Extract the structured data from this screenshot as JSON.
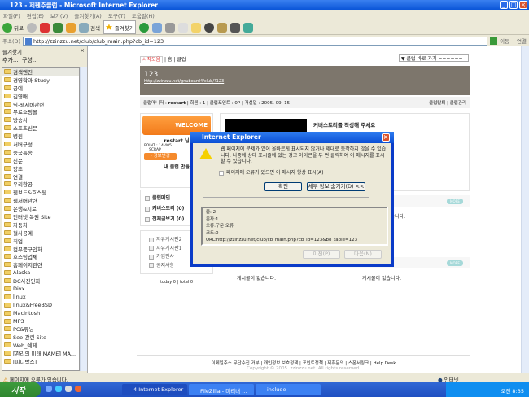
{
  "window": {
    "title": "123 - 제펜주클럽 - Microsoft Internet Explorer"
  },
  "menu": [
    "파일(F)",
    "편집(E)",
    "보기(V)",
    "즐겨찾기(A)",
    "도구(T)",
    "도움말(H)"
  ],
  "toolbar": {
    "back": "뒤로",
    "search": "검색",
    "favorites": "즐겨찾기"
  },
  "address": {
    "label": "주소(D)",
    "url": "http://zzinzzu.net/club/club_main.php?cb_id=123",
    "go": "이동",
    "links": "연결"
  },
  "favorites": {
    "title": "즐겨찾기",
    "add": "추가...",
    "organize": "구성...",
    "items": [
      "검색엔진",
      "경영학과-Study",
      "공예",
      "김영배",
      "딕-웹서버관련",
      "무료쇼핑몰",
      "방송사",
      "스포츠신문",
      "병원",
      "서버구성",
      "중국특송",
      "신문",
      "양초",
      "연결",
      "우리항공",
      "웹보드&호스팅",
      "웹서버관련",
      "은행&지로",
      "인터넷 복권 Site",
      "자동차",
      "철사공예",
      "취업",
      "컴부품구입처",
      "호스팅업체",
      "홈페이지관련",
      "Alaska",
      "DC사진인화",
      "Divx",
      "linux",
      "linux&FreeBSD",
      "Macintosh",
      "MP3",
      "PC&튜닝",
      "See-관련 Site",
      "Web_예제",
      "[관리의 미래 MAME] MA...",
      "[피디박스]"
    ]
  },
  "page": {
    "nav": [
      "시작모음",
      "홈",
      "클럽"
    ],
    "club_select": "▼ 클럽 바로 가기 ======",
    "club_name": "123",
    "club_url": "http://zzinzzu.net/gnuboard4/club/?123",
    "info": {
      "manager_label": "클럽매니저 :",
      "manager": "restart",
      "members": "| 회원 : 1 | 클럽포인트 : 0P | 개설일 : 2005. 09. 15"
    },
    "links": "클럽탈퇴 | 클럽관리",
    "welcome": "WELCOME",
    "user": "restart 님",
    "point": "POINT : 14,405",
    "scrap": "SCRAP",
    "btn_info": "· 정보변경",
    "make_club": "내 클럽 만들",
    "story_prompt": "커버스토리를 작성해 주세요",
    "menu": [
      "클럽메인",
      "커버스토리 (0)",
      "전체글보기 (0)"
    ],
    "boards": [
      "자유게시판2",
      "자유게시판1",
      "가입인사",
      "공지사항"
    ],
    "counter": "today 0 | total 0",
    "no_posts": "게시물이 없습니다.",
    "more": "MORE",
    "footer": "이메일주소 무단수집 거부 | 개인정보 보호정책 | 포인트정책 | 제휴문의 | 스폰서링크 | Help Desk",
    "copyright": "Copyright © 2005. zzinzzu.net. All rights reserved."
  },
  "dialog": {
    "title": "Internet Explorer",
    "message": "웹 페이지에 문제가 있어 올바르게 표시되지 않거나 제대로 동작하지 않을 수 있습니다. 나중에 상태 표시줄에 있는 경고 아이콘을 두 번 클릭하여 이 메시지를 표시할 수 있습니다.",
    "checkbox": "페이지에 오류가 있으면 이 메시지 항상 표시(A)",
    "ok": "확인",
    "details": "세부 정보 숨기기(D) <<",
    "details_lines": [
      "줄:  2",
      "문자:1",
      "오류:구문 오류",
      "코드:0",
      "URL:http://zzinzzu.net/club/cb_main.php?cb_id=123&bo_table=123"
    ],
    "prev": "이전(P)",
    "next": "다음(N)"
  },
  "status": {
    "text": "페이지에 오류가 있습니다.",
    "zone": "인터넷"
  },
  "taskbar": {
    "start": "시작",
    "tasks": [
      "4 Internet Explorer",
      "FileZilla - 마리내 ...",
      "include"
    ],
    "time": "오전 8:35"
  }
}
